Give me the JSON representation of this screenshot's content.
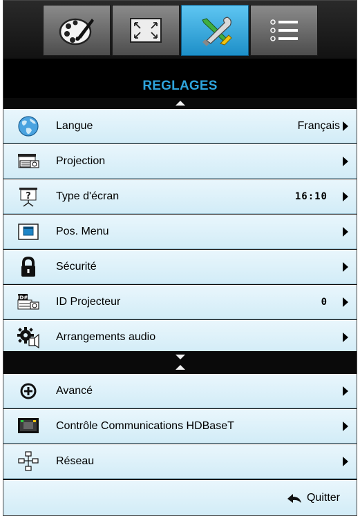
{
  "header": {
    "title": "REGLAGES"
  },
  "tabs": [
    {
      "name": "image",
      "icon": "palette-icon"
    },
    {
      "name": "display",
      "icon": "fullscreen-icon"
    },
    {
      "name": "setup",
      "icon": "tools-icon",
      "active": true
    },
    {
      "name": "options",
      "icon": "list-icon"
    }
  ],
  "menu": {
    "group1": [
      {
        "label": "Langue",
        "value": "Français",
        "icon": "globe-icon"
      },
      {
        "label": "Projection",
        "value": "",
        "icon": "projection-icon"
      },
      {
        "label": "Type d'écran",
        "value": "16:10",
        "icon": "screen-type-icon"
      },
      {
        "label": "Pos. Menu",
        "value": "",
        "icon": "menu-position-icon"
      },
      {
        "label": "Sécurité",
        "value": "",
        "icon": "lock-icon"
      },
      {
        "label": "ID Projecteur",
        "value": "0",
        "icon": "projector-id-icon"
      },
      {
        "label": "Arrangements audio",
        "value": "",
        "icon": "audio-settings-icon"
      }
    ],
    "group2": [
      {
        "label": "Avancé",
        "value": "",
        "icon": "plus-circle-icon"
      },
      {
        "label": "Contrôle Communications HDBaseT",
        "value": "",
        "icon": "network-port-icon"
      },
      {
        "label": "Réseau",
        "value": "",
        "icon": "network-tree-icon"
      }
    ]
  },
  "footer": {
    "quit_label": "Quitter",
    "quit_icon": "back-arrow-icon"
  },
  "colors": {
    "title": "#2ea4dc",
    "tab_active": "#2ea0da",
    "row_bg": "#e1f2f9",
    "frame": "#0a0a0a"
  }
}
